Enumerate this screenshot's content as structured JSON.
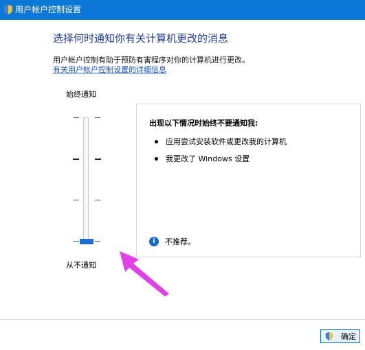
{
  "window": {
    "title": "用户帐户控制设置"
  },
  "main": {
    "heading": "选择何时通知你有关计算机更改的消息",
    "description": "用户帐户控制有助于预防有害程序对你的计算机进行更改。",
    "link": "有关用户帐户控制设置的详细信息"
  },
  "slider": {
    "top_label": "始终通知",
    "bottom_label": "从不通知",
    "level": "从不通知",
    "level_index": 0,
    "levels_count": 4
  },
  "panel": {
    "title": "出现以下情况时始终不要通知我:",
    "bullets": [
      "应用尝试安装软件或更改我的计算机",
      "我更改了 Windows 设置"
    ],
    "info_text": "不推荐。"
  },
  "footer": {
    "ok_label": "确定"
  },
  "colors": {
    "titlebar": "#0b78d7",
    "accent": "#1c6fd1",
    "annotation_arrow": "#e040e6"
  }
}
